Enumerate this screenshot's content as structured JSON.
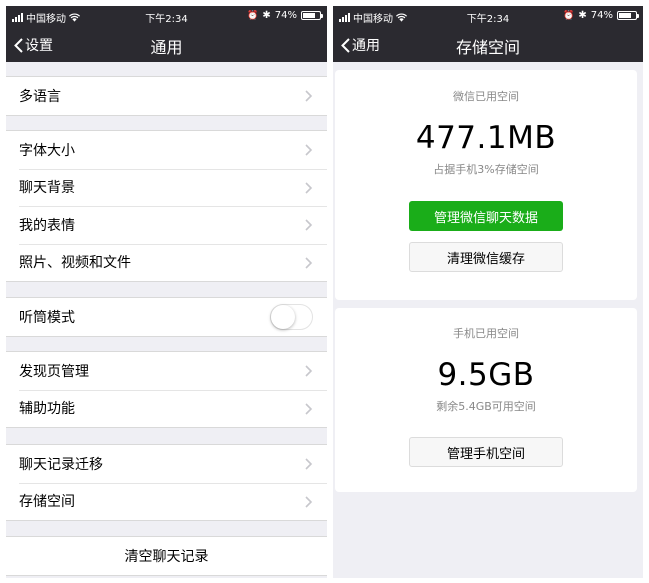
{
  "status": {
    "carrier": "中国移动",
    "time": "下午2:34",
    "battery_percent": "74%",
    "battery_level": 0.74
  },
  "left": {
    "nav": {
      "back_label": "设置",
      "title": "通用"
    },
    "group1": [
      {
        "label": "多语言"
      }
    ],
    "group2": [
      {
        "label": "字体大小"
      },
      {
        "label": "聊天背景"
      },
      {
        "label": "我的表情"
      },
      {
        "label": "照片、视频和文件"
      }
    ],
    "earpiece": {
      "label": "听筒模式",
      "on": false
    },
    "group4": [
      {
        "label": "发现页管理"
      },
      {
        "label": "辅助功能"
      }
    ],
    "group5": [
      {
        "label": "聊天记录迁移"
      },
      {
        "label": "存储空间"
      }
    ],
    "clear_button": "清空聊天记录"
  },
  "right": {
    "nav": {
      "back_label": "通用",
      "title": "存储空间"
    },
    "wechat_card": {
      "label": "微信已用空间",
      "size": "477.1MB",
      "sub": "占据手机3%存储空间",
      "manage_button": "管理微信聊天数据",
      "clear_cache_button": "清理微信缓存"
    },
    "phone_card": {
      "label": "手机已用空间",
      "size": "9.5GB",
      "sub": "剩余5.4GB可用空间",
      "manage_button": "管理手机空间"
    }
  },
  "colors": {
    "navbar": "#2b2a30",
    "background": "#efeff4",
    "primary_button": "#1aad19"
  }
}
